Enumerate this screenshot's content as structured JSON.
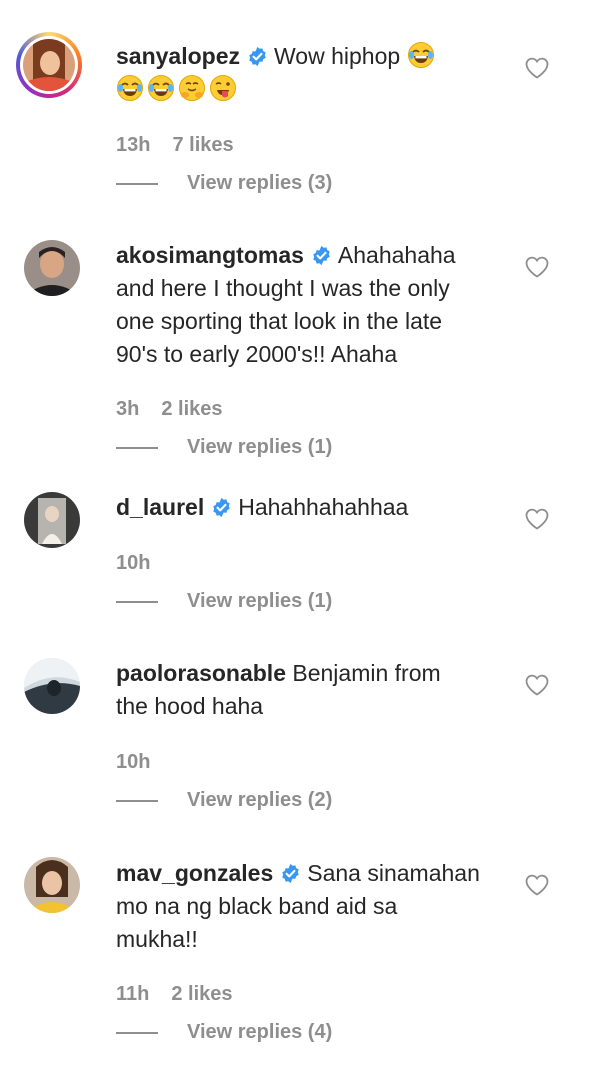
{
  "comments": [
    {
      "username": "sanyalopez",
      "verified": true,
      "text": "Wow hiphop",
      "emojis": [
        "rofl-emoji",
        "rofl-emoji",
        "rofl-emoji",
        "hugging-emoji",
        "tongue-wink-emoji"
      ],
      "time": "13h",
      "likes": "7 likes",
      "replies": "View replies (3)"
    },
    {
      "username": "akosimangtomas",
      "verified": true,
      "text_lines": [
        "Ahahahaha",
        "and here I thought I was the only",
        "one sporting that look in the late",
        "90's to early 2000's!! Ahaha"
      ],
      "time": "3h",
      "likes": "2 likes",
      "replies": "View replies (1)"
    },
    {
      "username": "d_laurel",
      "verified": true,
      "text": "Hahahhahahhaa",
      "time": "10h",
      "replies": "View replies (1)"
    },
    {
      "username": "paolorasonable",
      "verified": false,
      "text_lines": [
        "Benjamin from",
        "the hood haha"
      ],
      "time": "10h",
      "replies": "View replies (2)"
    },
    {
      "username": "mav_gonzales",
      "verified": true,
      "text_lines": [
        "Sana sinamahan",
        "mo na ng black band aid sa",
        "mukha!!"
      ],
      "time": "11h",
      "likes": "2 likes",
      "replies": "View replies (4)"
    }
  ],
  "colors": {
    "text": "#262626",
    "meta": "#8e8e8e",
    "verified": "#3897f0"
  }
}
